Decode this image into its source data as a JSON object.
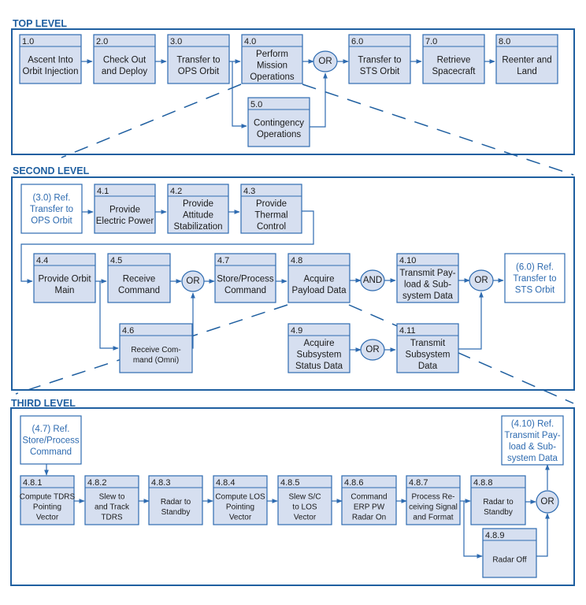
{
  "levels": {
    "top": {
      "title": "TOP LEVEL"
    },
    "second": {
      "title": "SECOND LEVEL"
    },
    "third": {
      "title": "THIRD LEVEL"
    }
  },
  "colors": {
    "accent": "#1f5fa0",
    "box_fill": "#d6dff0",
    "box_stroke": "#2e6bb0"
  },
  "nodes": {
    "n1_0": {
      "id": "1.0",
      "lines": [
        "Ascent Into",
        "Orbit Injection"
      ]
    },
    "n2_0": {
      "id": "2.0",
      "lines": [
        "Check Out",
        "and Deploy"
      ]
    },
    "n3_0": {
      "id": "3.0",
      "lines": [
        "Transfer to",
        "OPS Orbit"
      ]
    },
    "n4_0": {
      "id": "4.0",
      "lines": [
        "Perform",
        "Mission",
        "Operations"
      ]
    },
    "n5_0": {
      "id": "5.0",
      "lines": [
        "Contingency",
        "Operations"
      ]
    },
    "n6_0": {
      "id": "6.0",
      "lines": [
        "Transfer to",
        "STS Orbit"
      ]
    },
    "n7_0": {
      "id": "7.0",
      "lines": [
        "Retrieve",
        "Spacecraft"
      ]
    },
    "n8_0": {
      "id": "8.0",
      "lines": [
        "Reenter and",
        "Land"
      ]
    },
    "ref3_0": {
      "lines": [
        "(3.0) Ref.",
        "Transfer to",
        "OPS Orbit"
      ]
    },
    "n4_1": {
      "id": "4.1",
      "lines": [
        "Provide",
        "Electric Power"
      ]
    },
    "n4_2": {
      "id": "4.2",
      "lines": [
        "Provide",
        "Attitude",
        "Stabilization"
      ]
    },
    "n4_3": {
      "id": "4.3",
      "lines": [
        "Provide",
        "Thermal",
        "Control"
      ]
    },
    "n4_4": {
      "id": "4.4",
      "lines": [
        "Provide Orbit",
        "Main"
      ]
    },
    "n4_5": {
      "id": "4.5",
      "lines": [
        "Receive",
        "Command"
      ]
    },
    "n4_6": {
      "id": "4.6",
      "lines": [
        "Receive Com-",
        "mand (Omni)"
      ]
    },
    "n4_7": {
      "id": "4.7",
      "lines": [
        "Store/Process",
        "Command"
      ]
    },
    "n4_8": {
      "id": "4.8",
      "lines": [
        "Acquire",
        "Payload Data"
      ]
    },
    "n4_9": {
      "id": "4.9",
      "lines": [
        "Acquire",
        "Subsystem",
        "Status Data"
      ]
    },
    "n4_10": {
      "id": "4.10",
      "lines": [
        "Transmit Pay-",
        "load & Sub-",
        "system Data"
      ]
    },
    "n4_11": {
      "id": "4.11",
      "lines": [
        "Transmit",
        "Subsystem",
        "Data"
      ]
    },
    "ref6_0": {
      "lines": [
        "(6.0)  Ref.",
        "Transfer to",
        "STS Orbit"
      ]
    },
    "ref4_7": {
      "lines": [
        "(4.7) Ref.",
        "Store/Process",
        "Command"
      ]
    },
    "ref4_10": {
      "lines": [
        "(4.10) Ref.",
        "Transmit Pay-",
        "load & Sub-",
        "system Data"
      ]
    },
    "n4_8_1": {
      "id": "4.8.1",
      "lines": [
        "Compute TDRS",
        "Pointing",
        "Vector"
      ]
    },
    "n4_8_2": {
      "id": "4.8.2",
      "lines": [
        "Slew to",
        "and Track",
        "TDRS"
      ]
    },
    "n4_8_3": {
      "id": "4.8.3",
      "lines": [
        "Radar to",
        "Standby"
      ]
    },
    "n4_8_4": {
      "id": "4.8.4",
      "lines": [
        "Compute LOS",
        "Pointing",
        "Vector"
      ]
    },
    "n4_8_5": {
      "id": "4.8.5",
      "lines": [
        "Slew S/C",
        "to LOS",
        "Vector"
      ]
    },
    "n4_8_6": {
      "id": "4.8.6",
      "lines": [
        "Command",
        "ERP PW",
        "Radar On"
      ]
    },
    "n4_8_7": {
      "id": "4.8.7",
      "lines": [
        "Process Re-",
        "ceiving Signal",
        "and Format"
      ]
    },
    "n4_8_8": {
      "id": "4.8.8",
      "lines": [
        "Radar to",
        "Standby"
      ]
    },
    "n4_8_9": {
      "id": "4.8.9",
      "lines": [
        "Radar Off"
      ]
    }
  },
  "gates": {
    "g_top_or": "OR",
    "g_l2_or1": "OR",
    "g_l2_and": "AND",
    "g_l2_or2": "OR",
    "g_l2_or3": "OR",
    "g_l3_or": "OR"
  }
}
